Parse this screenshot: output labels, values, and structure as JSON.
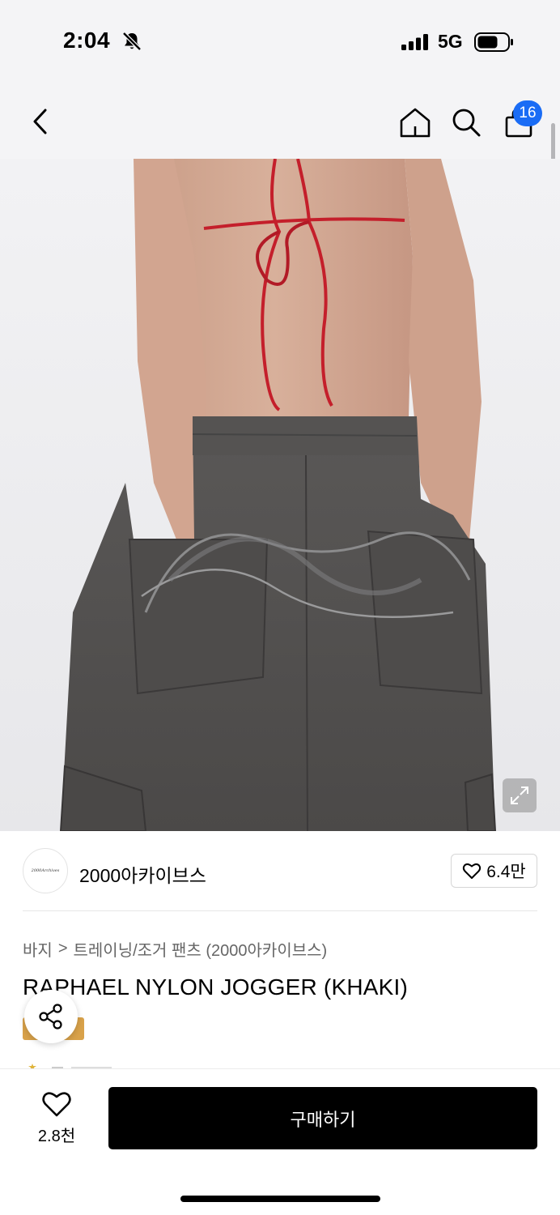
{
  "status_bar": {
    "time": "2:04",
    "network": "5G"
  },
  "nav": {
    "cart_count": "16"
  },
  "brand": {
    "logo_text": "2000Archives",
    "name": "2000아카이브스",
    "likes": "6.4만"
  },
  "breadcrumb": {
    "category": "바지",
    "separator": ">",
    "subcategory": "트레이닝/조거 팬츠 (2000아카이브스)"
  },
  "product": {
    "title": "RAPHAEL NYLON JOGGER (KHAKI)"
  },
  "bottom_bar": {
    "wish_count": "2.8천",
    "buy_label": "구매하기"
  },
  "colors": {
    "accent": "#1a6cf5",
    "buy_button": "#000000",
    "promo_tag": "#d9a24a"
  }
}
